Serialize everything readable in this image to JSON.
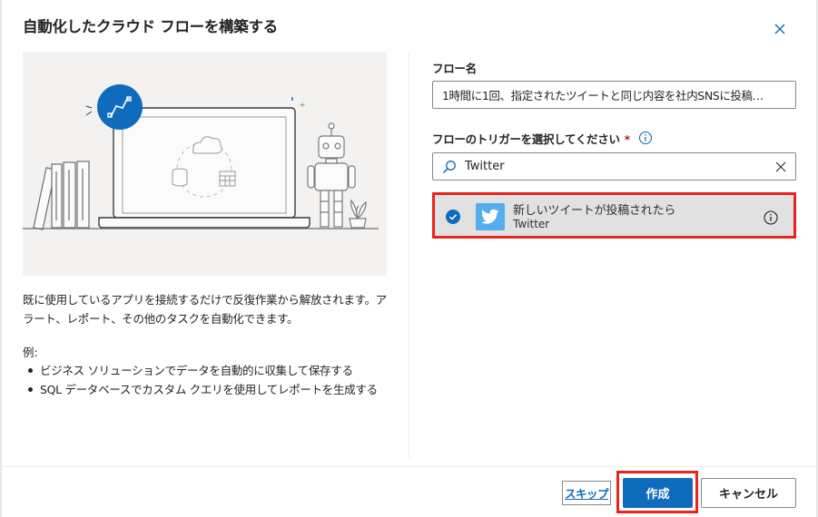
{
  "dialog": {
    "title": "自動化したクラウド フローを構築する"
  },
  "intro": {
    "description": "既に使用しているアプリを接続するだけで反復作業から解放されます。アラート、レポート、その他のタスクを自動化できます。",
    "example_label": "例:",
    "examples": [
      "ビジネス ソリューションでデータを自動的に収集して保存する",
      "SQL データベースでカスタム クエリを使用してレポートを生成する"
    ]
  },
  "form": {
    "flow_name_label": "フロー名",
    "flow_name_value": "1時間に1回、指定されたツイートと同じ内容を社内SNSに投稿…",
    "trigger_label": "フローのトリガーを選択してください",
    "required_mark": "*",
    "search_value": "Twitter",
    "triggers": [
      {
        "name": "新しいツイートが投稿されたら",
        "connector": "Twitter",
        "selected": true
      }
    ]
  },
  "footer": {
    "skip": "スキップ",
    "create": "作成",
    "cancel": "キャンセル"
  },
  "colors": {
    "primary": "#0f6cbd",
    "twitter": "#55acee",
    "highlight": "#e8251a",
    "selected_bg": "#e1e1e1",
    "hero_bg": "#f3f2f1"
  },
  "icons": [
    "close-icon",
    "info-icon",
    "search-icon",
    "clear-icon",
    "checkmark-circle-icon",
    "twitter-icon",
    "flow-icon",
    "cloud-icon",
    "database-icon",
    "calendar-icon",
    "robot-icon",
    "plant-icon",
    "laptop-icon"
  ]
}
